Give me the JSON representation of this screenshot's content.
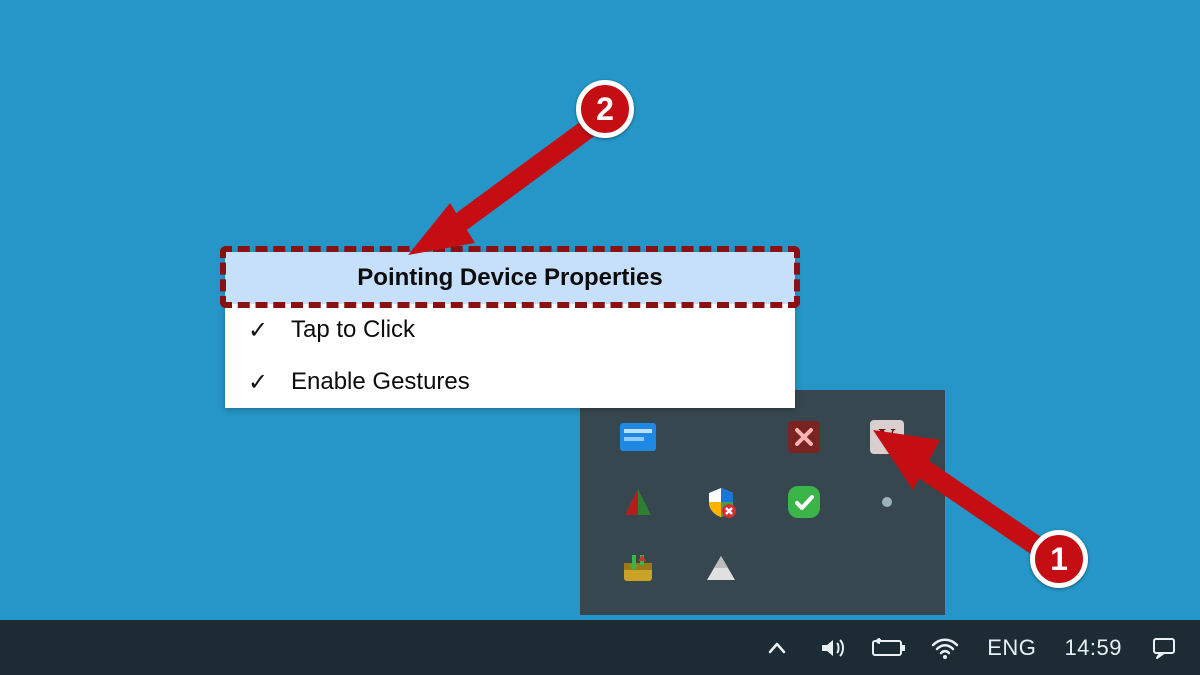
{
  "context_menu": {
    "items": [
      {
        "label": "Pointing Device Properties",
        "checked": false,
        "highlighted": true
      },
      {
        "label": "Tap to Click",
        "checked": true,
        "highlighted": false
      },
      {
        "label": "Enable Gestures",
        "checked": true,
        "highlighted": false
      }
    ]
  },
  "annotations": {
    "step1": "1",
    "step2": "2"
  },
  "tray_flyout": {
    "icons": [
      "app-icon-blue",
      "blank",
      "close-red-icon",
      "v-badge-icon",
      "triangle-icon",
      "security-shield-icon",
      "check-green-icon",
      "wifi-dot-icon",
      "download-box-icon",
      "drive-triangle-icon",
      "blank",
      "blank"
    ]
  },
  "taskbar": {
    "language": "ENG",
    "clock": "14:59",
    "icons": [
      "show-hidden-chevron-icon",
      "volume-icon",
      "battery-icon",
      "wifi-icon"
    ],
    "action_center": "action-center-icon"
  }
}
